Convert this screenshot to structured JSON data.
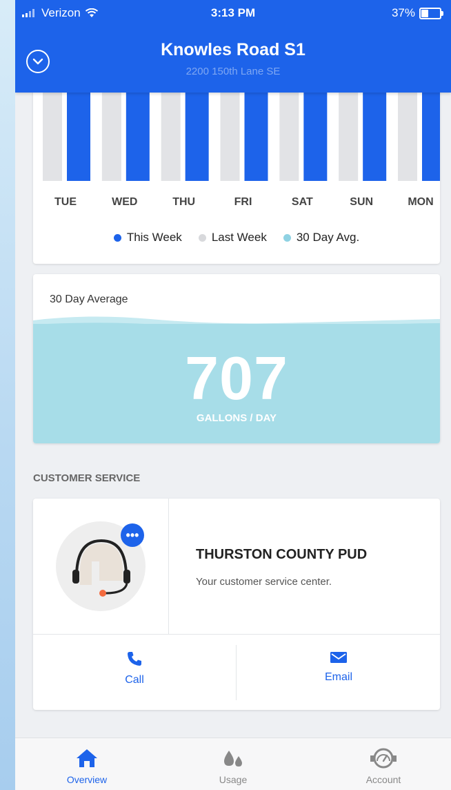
{
  "status_bar": {
    "carrier": "Verizon",
    "time": "3:13 PM",
    "battery": "37%",
    "battery_level": 0.37
  },
  "header": {
    "title": "Knowles Road S1",
    "subtitle": "2200 150th Lane SE",
    "collapse_icon": "chevron-down-circle-icon"
  },
  "colors": {
    "brand": "#1d63ea",
    "last_week": "#e2e3e6",
    "avg": "#8fd2e3",
    "avg_fill": "#a7dde8"
  },
  "chart_data": {
    "type": "bar",
    "categories": [
      "TUE",
      "WED",
      "THU",
      "FRI",
      "SAT",
      "SUN",
      "MON"
    ],
    "series": [
      {
        "name": "This Week",
        "color": "#1d63ea"
      },
      {
        "name": "Last Week",
        "color": "#e2e3e6"
      },
      {
        "name": "30 Day Avg.",
        "color": "#8fd2e3"
      }
    ],
    "legend_position": "bottom",
    "note": "bars extend above visible scroll area; values not readable"
  },
  "average": {
    "label": "30 Day Average",
    "value": "707",
    "unit": "GALLONS / DAY"
  },
  "customer_service": {
    "section_title": "CUSTOMER SERVICE",
    "name": "THURSTON COUNTY PUD",
    "description": "Your customer service center.",
    "chat_icon": "chat-dots-icon",
    "call_label": "Call",
    "email_label": "Email"
  },
  "tabs": [
    {
      "label": "Overview",
      "icon": "home-icon",
      "active": true
    },
    {
      "label": "Usage",
      "icon": "water-drops-icon",
      "active": false
    },
    {
      "label": "Account",
      "icon": "meter-icon",
      "active": false
    }
  ]
}
